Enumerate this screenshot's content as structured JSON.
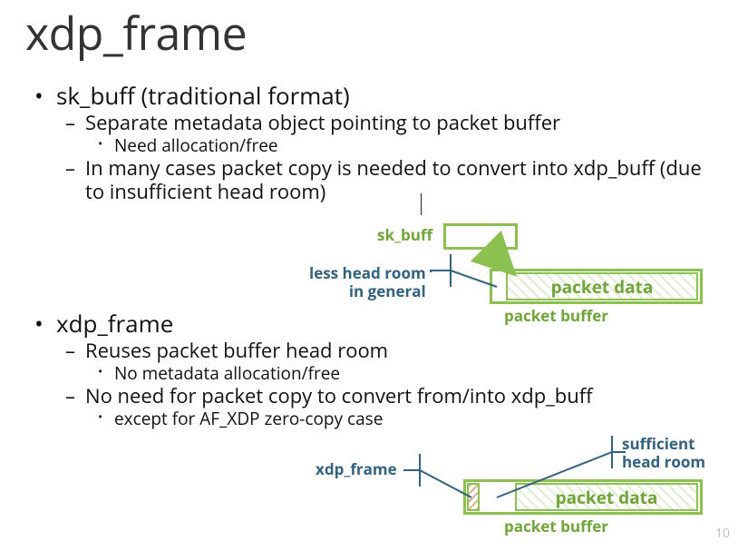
{
  "title": "xdp_frame",
  "pagenum": "10",
  "bullets": {
    "skbuff": {
      "heading": "sk_buff (traditional format)",
      "sub1": "Separate metadata object pointing to packet buffer",
      "sub1a": "Need allocation/free",
      "sub2": "In many cases packet copy is needed to convert into xdp_buff (due to insufficient head room)"
    },
    "xdpframe": {
      "heading": "xdp_frame",
      "sub1": "Reuses packet buffer head room",
      "sub1a": "No metadata allocation/free",
      "sub2": "No need for packet copy to convert from/into xdp_buff",
      "sub2a": "except for AF_XDP zero-copy case"
    }
  },
  "diagram": {
    "top": {
      "skbuff_label": "sk_buff",
      "less_headroom": "less head room\nin general",
      "packet_data": "packet data",
      "packet_buffer": "packet buffer"
    },
    "bottom": {
      "xdp_frame_label": "xdp_frame",
      "sufficient": "sufficient\nhead room",
      "packet_data": "packet data",
      "packet_buffer": "packet buffer"
    }
  },
  "colors": {
    "green": "#8cc152",
    "green_text": "#6fa53a",
    "blue": "#33617e"
  }
}
